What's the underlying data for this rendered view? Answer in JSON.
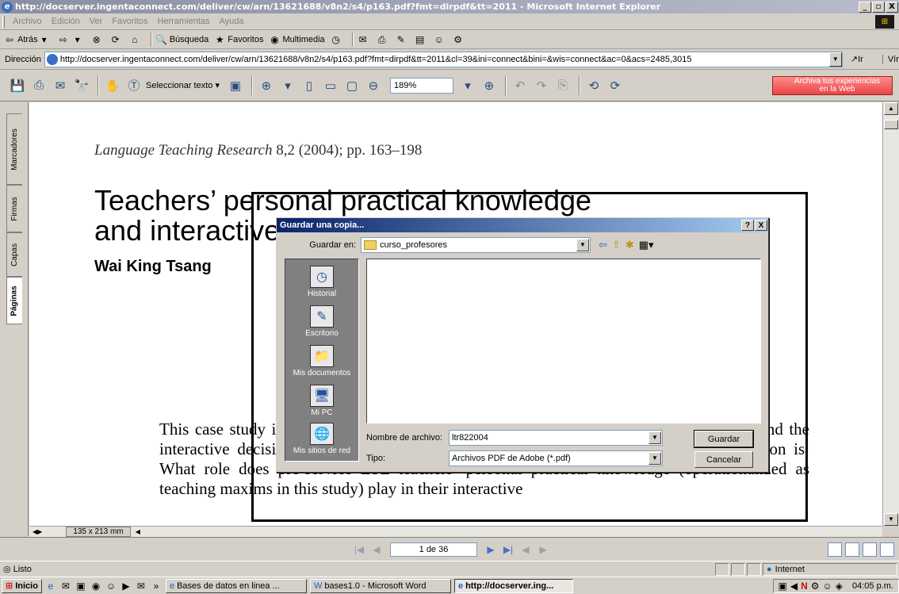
{
  "window": {
    "title": "http://docserver.ingentaconnect.com/deliver/cw/arn/13621688/v8n2/s4/p163.pdf?fmt=dirpdf&tt=2011 - Microsoft Internet Explorer",
    "btn_min": "_",
    "btn_max": "̸",
    "btn_close": "X"
  },
  "menu": {
    "items": [
      "Archivo",
      "Edición",
      "Ver",
      "Favoritos",
      "Herramientas",
      "Ayuda"
    ]
  },
  "ie_toolbar": {
    "back": "Atrás",
    "search": "Búsqueda",
    "favorites": "Favoritos",
    "media": "Multimedia"
  },
  "address": {
    "label": "Dirección",
    "url": "http://docserver.ingentaconnect.com/deliver/cw/arn/13621688/v8n2/s4/p163.pdf?fmt=dirpdf&tt=2011&cl=39&ini=connect&bini=&wis=connect&ac=0&acs=2485,3015",
    "go": "Ir",
    "links": "Vínculos"
  },
  "acrobat": {
    "select_text": "Seleccionar texto",
    "zoom": "189%",
    "archiva_line1": "Archiva tus experiencias",
    "archiva_line2": "en la Web"
  },
  "nav_tabs": [
    "Marcadores",
    "Firmas",
    "Capas",
    "Páginas"
  ],
  "document": {
    "journal_name": "Language Teaching Research",
    "journal_ref": " 8,2 (2004); pp. 163–198",
    "title_line1": "Teachers’ personal practical knowledge",
    "title_line2": "and interactive decisions",
    "author": "Wai King Tsang",
    "abstract": "This case study investigates the relationship between the personal practical knowledge and the interactive decisions of three pre-service non-native ESL teachers. The research question is: What role does pre-service ESL teachers’ personal practical knowledge (operationalized as teaching maxims in this study) play in their interactive"
  },
  "page_nav": {
    "page_size": "135 x 213 mm",
    "page_field": "1 de 36"
  },
  "status": {
    "text": "Listo",
    "zone": "Internet"
  },
  "taskbar": {
    "start": "Inicio",
    "more": "»",
    "tasks": [
      "Bases de datos en linea ...",
      "bases1.0 - Microsoft Word",
      "http://docserver.ing..."
    ],
    "time": "04:05 p.m."
  },
  "dialog": {
    "title": "Guardar una copia...",
    "help_btn": "?",
    "close_btn": "X",
    "save_in_label": "Guardar en:",
    "save_in_value": "curso_profesores",
    "places": [
      "Historial",
      "Escritorio",
      "Mis documentos",
      "Mi PC",
      "Mis sitios de red"
    ],
    "filename_label": "Nombre de archivo:",
    "filename_value": "ltr822004",
    "type_label": "Tipo:",
    "type_value": "Archivos PDF de Adobe (*.pdf)",
    "save_button": "Guardar",
    "cancel_button": "Cancelar"
  }
}
